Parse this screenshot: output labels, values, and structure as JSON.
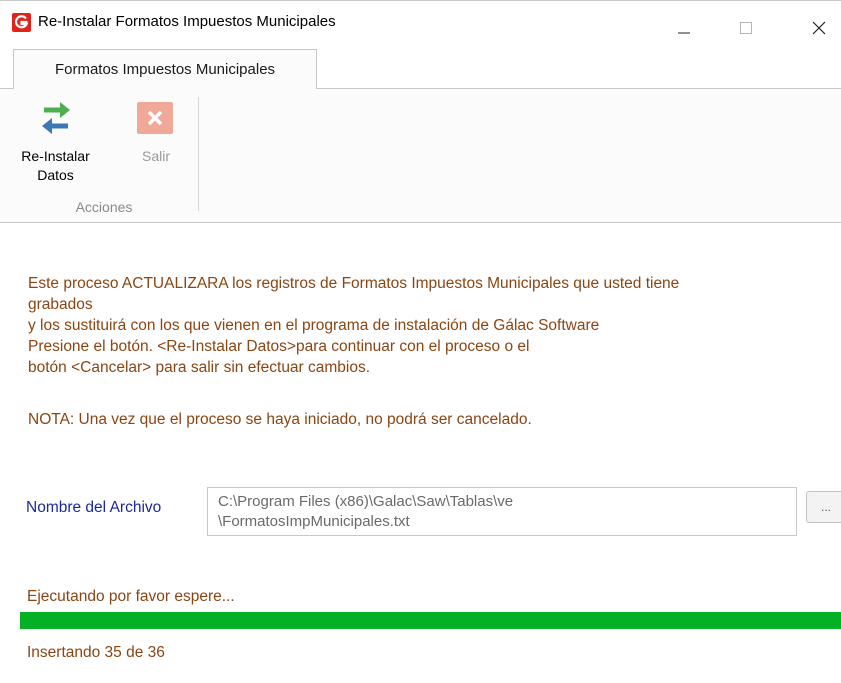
{
  "window": {
    "title": "Re-Instalar Formatos Impuestos Municipales",
    "controls": {
      "minimize_icon": "minimize-icon",
      "maximize_icon": "maximize-icon",
      "close_icon": "close-icon"
    }
  },
  "ribbon": {
    "tab_label": "Formatos Impuestos Municipales",
    "group_label": "Acciones",
    "buttons": [
      {
        "label_line1": "Re-Instalar",
        "label_line2": "Datos",
        "icon": "swap-arrows-icon",
        "enabled": true
      },
      {
        "label_line1": "Salir",
        "icon": "close-box-icon",
        "enabled": false
      }
    ]
  },
  "message": {
    "lines": [
      "Este proceso ACTUALIZARA los registros de Formatos Impuestos Municipales que usted tiene",
      "grabados",
      "y los sustituirá con los que vienen en el programa de instalación de Gálac Software",
      "Presione el botón.  <Re-Instalar Datos>para continuar con el proceso o el",
      "botón <Cancelar> para salir sin efectuar cambios."
    ],
    "note": "NOTA: Una vez que el proceso se haya iniciado, no podrá ser cancelado."
  },
  "file": {
    "label": "Nombre del Archivo",
    "value_line1": "C:\\Program Files (x86)\\Galac\\Saw\\Tablas\\ve",
    "value_line2": "\\FormatosImpMunicipales.txt",
    "browse_label": "..."
  },
  "status": {
    "text": "Ejecutando por favor espere...",
    "progress_fraction": 1.0,
    "caption": "Insertando 35 de 36"
  },
  "colors": {
    "accent_red": "#e2231a",
    "message_text": "#8b4513",
    "label_blue": "#1a2a9a",
    "progress_green": "#06b025",
    "arrow_green": "#4caf50",
    "arrow_blue": "#3b78b5",
    "salir_disabled": "#f0a898"
  }
}
